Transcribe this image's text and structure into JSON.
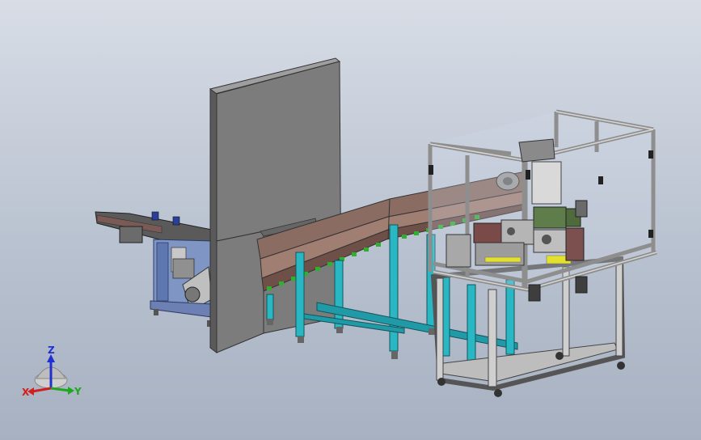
{
  "viewport": {
    "background_top": "#d8dde6",
    "background_bottom": "#a7b1c1"
  },
  "triad": {
    "x_label": "X",
    "y_label": "Y",
    "z_label": "Z",
    "x_color": "#d21f1f",
    "y_color": "#1fa81f",
    "z_color": "#1f2fd2"
  },
  "model": {
    "icon": "assembly-model-icon"
  }
}
